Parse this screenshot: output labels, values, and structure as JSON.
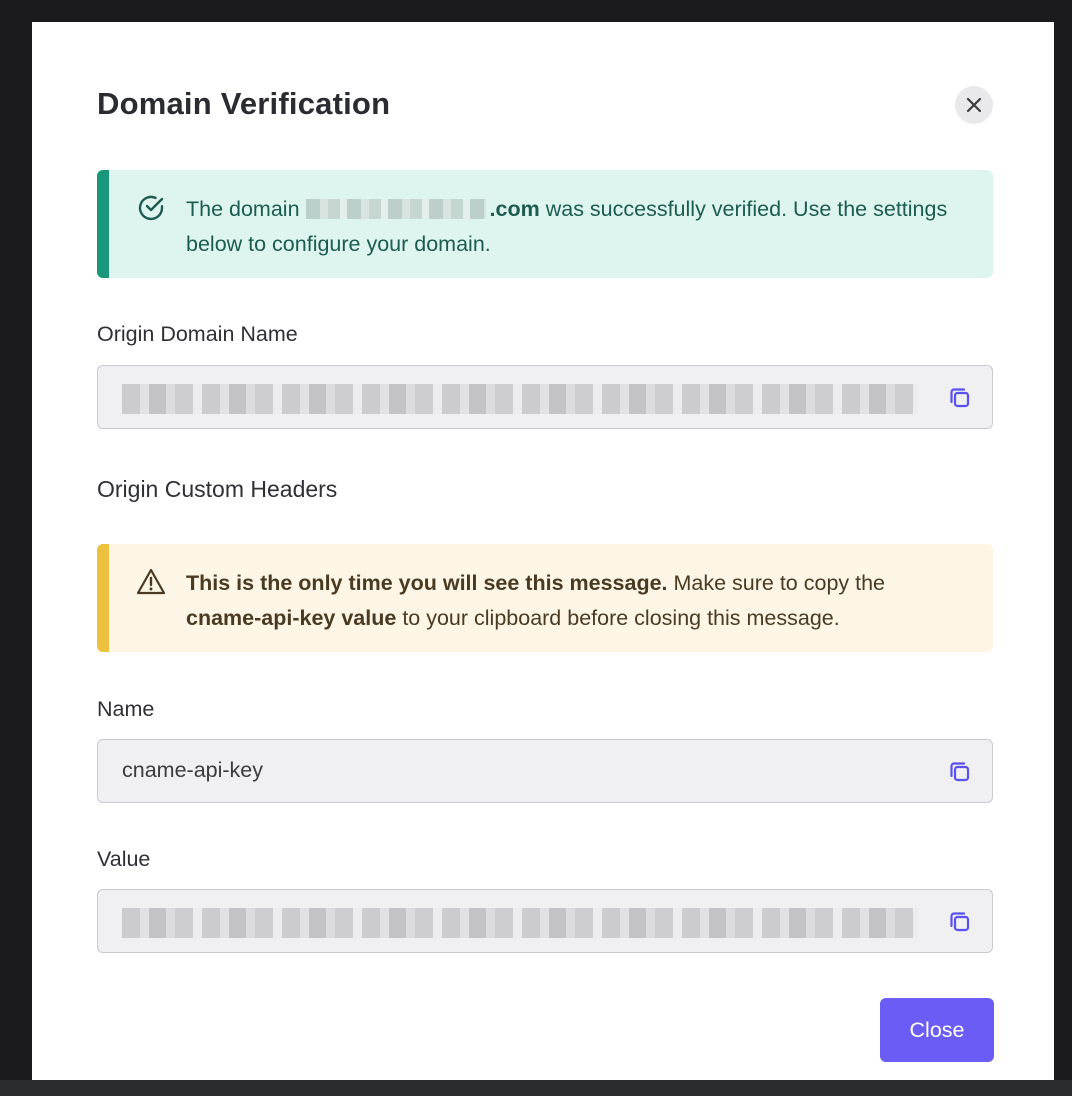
{
  "dialog": {
    "title": "Domain Verification",
    "close_icon": "close-icon"
  },
  "success_alert": {
    "icon": "check-circle-icon",
    "prefix": "The domain",
    "domain_suffix": ".com",
    "suffix": " was successfully verified. Use the settings below to configure your domain.",
    "accent_color": "#18977a",
    "background": "#def5ef"
  },
  "origin_domain": {
    "label": "Origin Domain Name",
    "copy_icon": "copy-icon"
  },
  "headers_section": {
    "title": "Origin Custom Headers"
  },
  "warning_alert": {
    "icon": "warning-triangle-icon",
    "bold_lead": "This is the only time you will see this message.",
    "text_mid": " Make sure to copy the ",
    "bold_key": "cname-api-key value",
    "text_end": " to your clipboard before closing this message.",
    "accent_color": "#edc13d",
    "background": "#fdf6e6"
  },
  "name_field": {
    "label": "Name",
    "value": "cname-api-key",
    "copy_icon": "copy-icon"
  },
  "value_field": {
    "label": "Value",
    "copy_icon": "copy-icon"
  },
  "footer": {
    "close_label": "Close",
    "button_color": "#6a5cf5"
  }
}
